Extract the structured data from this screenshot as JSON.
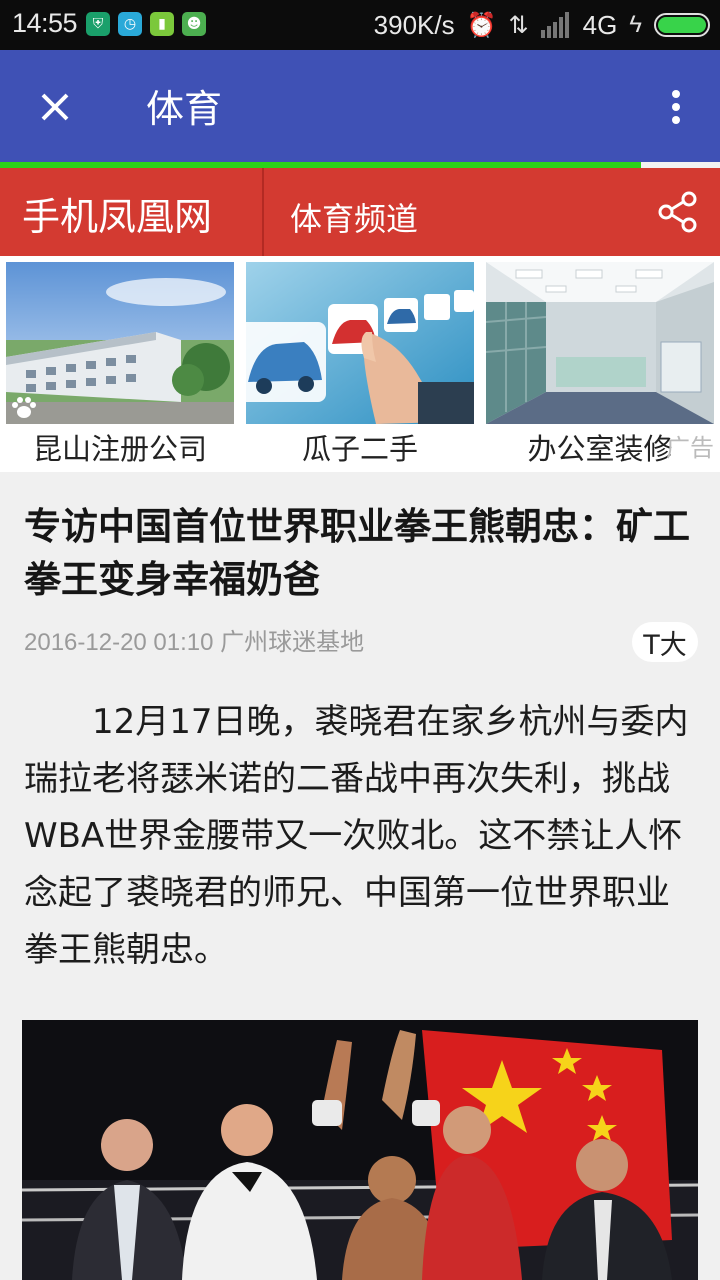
{
  "status_bar": {
    "time": "14:55",
    "net_speed": "390K/s",
    "network": "4G"
  },
  "toolbar": {
    "title": "体育"
  },
  "page_load_progress_percent": 89,
  "channel_header": {
    "site_name": "手机凤凰网",
    "channel_name": "体育频道"
  },
  "ads": {
    "items": [
      {
        "label": "昆山注册公司"
      },
      {
        "label": "瓜子二手"
      },
      {
        "label": "办公室装修"
      }
    ],
    "marker": "广告"
  },
  "article": {
    "title": "专访中国首位世界职业拳王熊朝忠：矿工拳王变身幸福奶爸",
    "meta": "2016-12-20 01:10 广州球迷基地",
    "font_size_button": "T大",
    "body": "12月17日晚，裘晓君在家乡杭州与委内瑞拉老将瑟米诺的二番战中再次失利，挑战WBA世界金腰带又一次败北。这不禁让人怀念起了裘晓君的师兄、中国第一位世界职业拳王熊朝忠。"
  },
  "colors": {
    "toolbar": "#3f51b5",
    "channel_bar": "#d33a31",
    "progress": "#2bd21a",
    "battery": "#38d34a"
  }
}
